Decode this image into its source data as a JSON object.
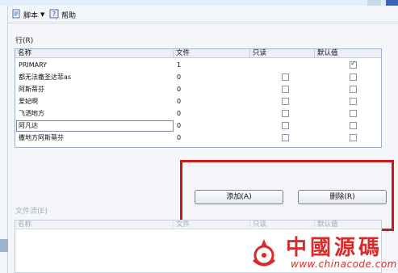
{
  "toolbar": {
    "script_label": "脚本",
    "help_label": "帮助"
  },
  "rows_section": {
    "label": "行(R)",
    "columns": [
      "名称",
      "文件",
      "只读",
      "默认值"
    ],
    "rows": [
      {
        "name": "PRIMARY",
        "files": "1",
        "readonly": null,
        "default": true
      },
      {
        "name": "都无法撒圣达菲as",
        "files": "0",
        "readonly": false,
        "default": false
      },
      {
        "name": "阿斯蒂芬",
        "files": "0",
        "readonly": false,
        "default": false
      },
      {
        "name": "爱妃啊",
        "files": "0",
        "readonly": false,
        "default": false
      },
      {
        "name": "飞洒地方",
        "files": "0",
        "readonly": false,
        "default": false
      },
      {
        "name": "阿凡达",
        "files": "0",
        "readonly": false,
        "default": false
      },
      {
        "name": "撒地方阿斯蒂芬",
        "files": "0",
        "readonly": false,
        "default": false
      }
    ]
  },
  "buttons": {
    "add_label": "添加(A)",
    "remove_label": "删除(R)"
  },
  "filestream_section": {
    "label": "文件流(E)",
    "columns": [
      "名称",
      "文件",
      "只读",
      "默认值"
    ]
  },
  "watermark": {
    "brand_text": "中國源碼",
    "url_text": "www.chinacode.com"
  },
  "colors": {
    "highlight_border": "#cc1a1a",
    "check_mark": "#1d8a2b",
    "watermark": "#d92b2b"
  }
}
